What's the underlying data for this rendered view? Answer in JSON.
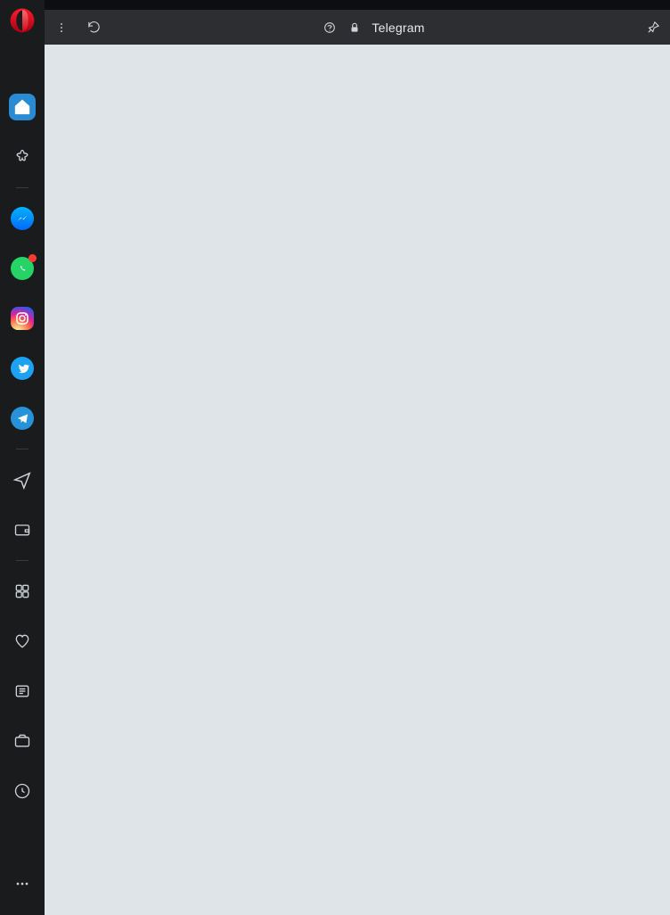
{
  "address_bar": {
    "site_label": "Telegram"
  },
  "sidebar": {
    "items": [
      {
        "id": "opera-logo",
        "type": "logo"
      },
      {
        "id": "home",
        "type": "nav",
        "active": true
      },
      {
        "id": "pinboards",
        "type": "nav"
      },
      {
        "id": "divider"
      },
      {
        "id": "messenger",
        "type": "social"
      },
      {
        "id": "whatsapp",
        "type": "social",
        "badge": true
      },
      {
        "id": "instagram",
        "type": "social"
      },
      {
        "id": "twitter",
        "type": "social"
      },
      {
        "id": "telegram",
        "type": "social"
      },
      {
        "id": "divider"
      },
      {
        "id": "flow",
        "type": "tool"
      },
      {
        "id": "wallet",
        "type": "tool"
      },
      {
        "id": "divider"
      },
      {
        "id": "workspaces",
        "type": "tool"
      },
      {
        "id": "favorites",
        "type": "tool"
      },
      {
        "id": "news",
        "type": "tool"
      },
      {
        "id": "snapshot",
        "type": "tool"
      },
      {
        "id": "history",
        "type": "tool"
      },
      {
        "id": "more",
        "type": "tool"
      }
    ]
  }
}
